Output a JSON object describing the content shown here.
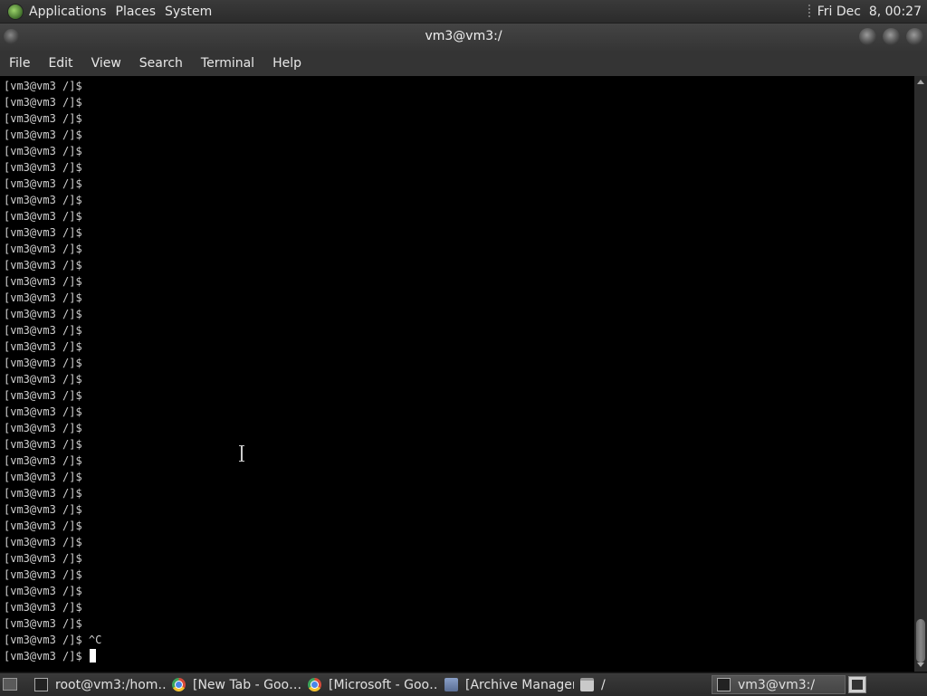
{
  "top_panel": {
    "menus": [
      "Applications",
      "Places",
      "System"
    ],
    "clock": "Fri Dec  8, 00:27"
  },
  "window": {
    "title": "vm3@vm3:/"
  },
  "menubar": {
    "items": [
      "File",
      "Edit",
      "View",
      "Search",
      "Terminal",
      "Help"
    ]
  },
  "terminal": {
    "prompt": "[vm3@vm3 /]$",
    "repeated_prompt_count": 34,
    "interrupt_line": "[vm3@vm3 /]$ ^C",
    "current_line": "[vm3@vm3 /]$ "
  },
  "taskbar": {
    "tasks": [
      {
        "label": "root@vm3:/hom…",
        "icon": "terminal-icon"
      },
      {
        "label": "[New Tab - Goo…",
        "icon": "chrome-icon"
      },
      {
        "label": "[Microsoft - Goo…",
        "icon": "chrome-icon"
      },
      {
        "label": "[Archive Manager]",
        "icon": "archive-icon"
      },
      {
        "label": "/",
        "icon": "folder-icon"
      },
      {
        "label": "vm3@vm3:/",
        "icon": "terminal-icon"
      }
    ]
  }
}
